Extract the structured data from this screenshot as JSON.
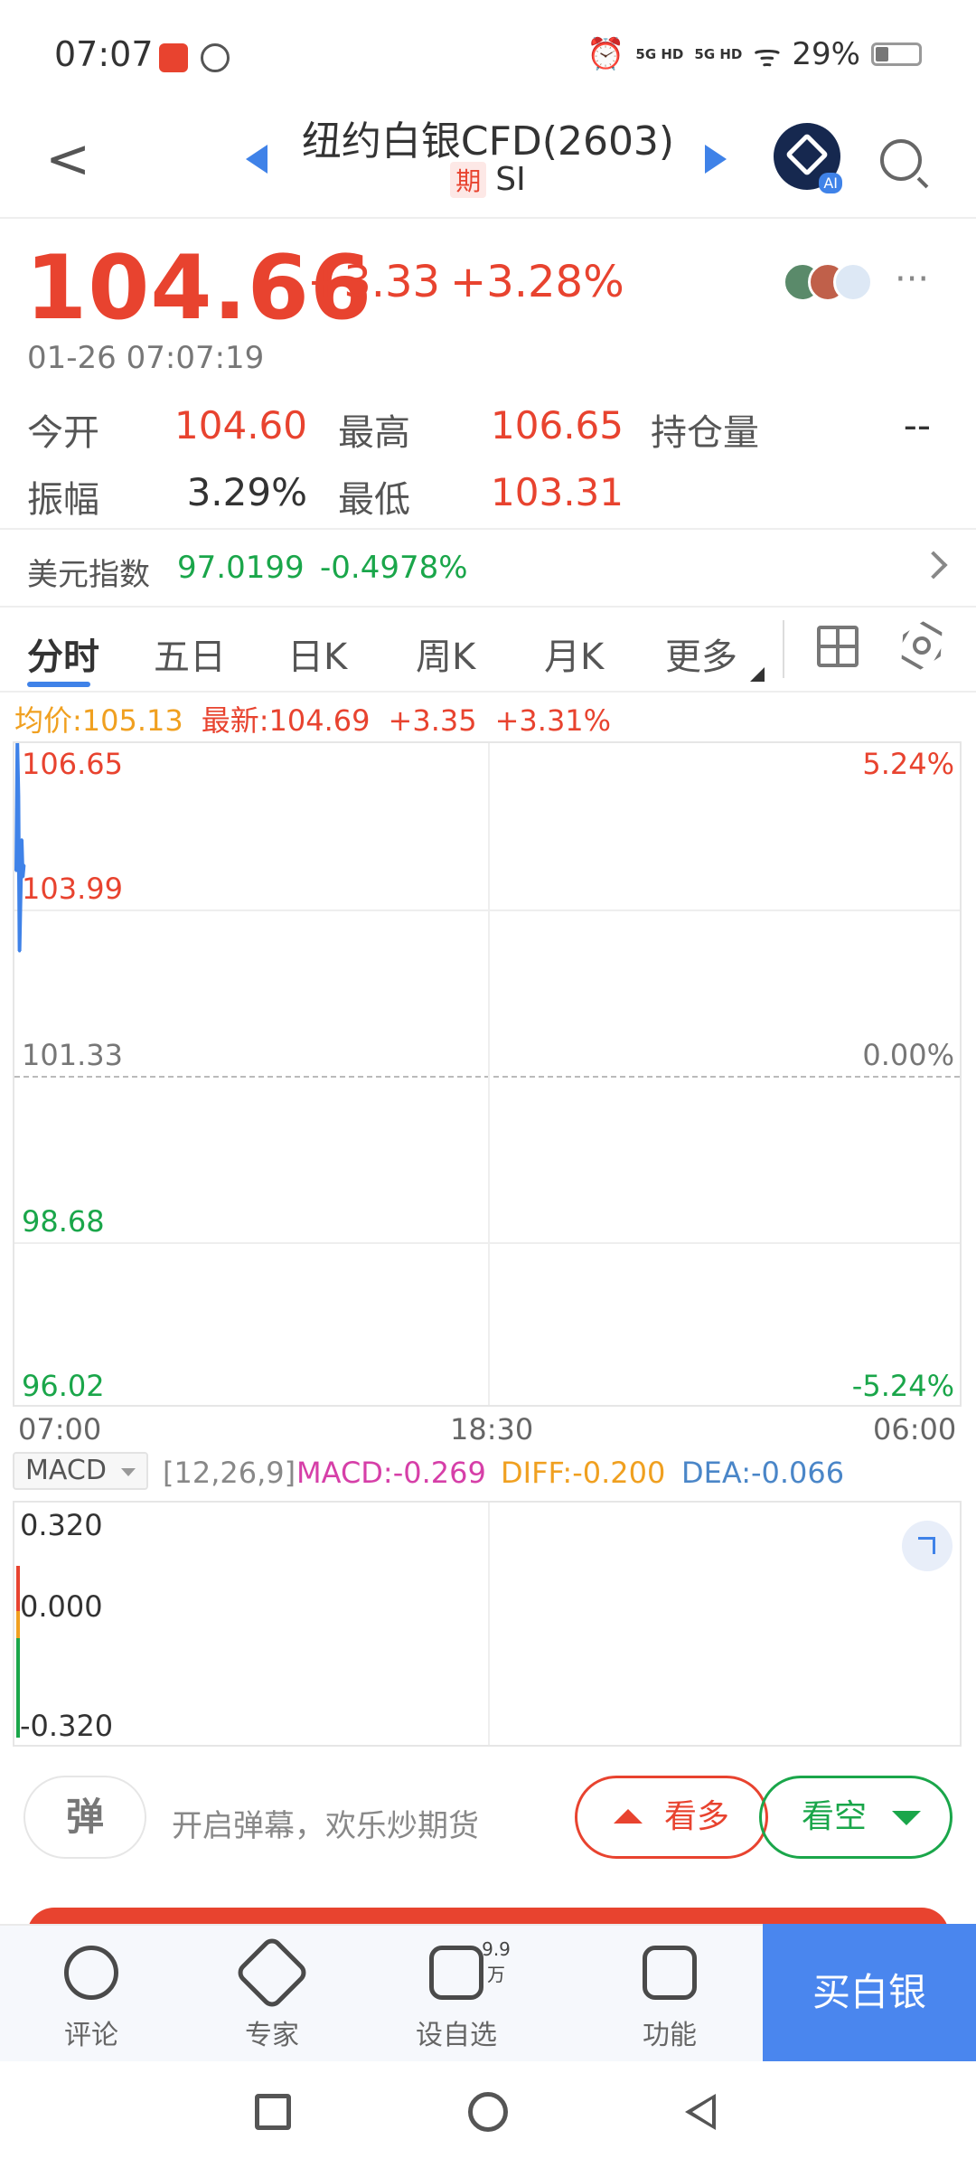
{
  "status_bar": {
    "time": "07:07",
    "network1": "5G HD",
    "network2": "5G HD",
    "battery": "29%"
  },
  "header": {
    "title": "纽约白银CFD(2603)",
    "tag": "期",
    "symbol": "SI",
    "ai_badge": "AI"
  },
  "quote": {
    "price": "104.66",
    "change": "+3.33",
    "change_pct": "+3.28%",
    "timestamp": "01-26 07:07:19",
    "more": "···"
  },
  "stats": {
    "open_label": "今开",
    "open": "104.60",
    "high_label": "最高",
    "high": "106.65",
    "oi_label": "持仓量",
    "oi": "--",
    "amp_label": "振幅",
    "amp": "3.29%",
    "low_label": "最低",
    "low": "103.31"
  },
  "dollar_index": {
    "label": "美元指数",
    "value": "97.0199",
    "change": "-0.4978%"
  },
  "tabs": [
    "分时",
    "五日",
    "日K",
    "周K",
    "月K",
    "更多"
  ],
  "chart_info": {
    "avg": "均价:105.13",
    "latest": "最新:104.69",
    "chg": "+3.35",
    "pct": "+3.31%"
  },
  "chart_data": {
    "type": "line",
    "y_left_ticks": [
      "106.65",
      "103.99",
      "101.33",
      "98.68",
      "96.02"
    ],
    "y_right_ticks": [
      "5.24%",
      "",
      "0.00%",
      "",
      "-5.24%"
    ],
    "x_ticks": [
      "07:00",
      "18:30",
      "06:00"
    ],
    "ylim": [
      96.02,
      106.65
    ],
    "series": [
      {
        "x": [
          "07:00",
          "07:01",
          "07:02",
          "07:03",
          "07:04",
          "07:05",
          "07:06",
          "07:07"
        ],
        "values": [
          104.6,
          106.65,
          105.8,
          103.31,
          104.2,
          105.1,
          104.5,
          104.69
        ]
      }
    ]
  },
  "macd": {
    "selector": "MACD",
    "params": "[12,26,9]",
    "macd": "MACD:-0.269",
    "diff": "DIFF:-0.200",
    "dea": "DEA:-0.066",
    "ticks": [
      "0.320",
      "0.000",
      "-0.320"
    ],
    "colors": {
      "macd": "#d63fa8",
      "diff": "#f0a020",
      "dea": "#4a86c8"
    }
  },
  "danmu": {
    "button": "弹",
    "placeholder": "开启弹幕，欢乐炒期货"
  },
  "sentiment": {
    "bull": "看多",
    "bear": "看空"
  },
  "toolbar": {
    "comment": "评论",
    "expert": "专家",
    "watch": "设自选",
    "watch_count": "9.9万",
    "func": "功能",
    "buy": "买白银"
  },
  "colors": {
    "up": "#e8432f",
    "down": "#1aa64a",
    "accent": "#4a86ee"
  }
}
